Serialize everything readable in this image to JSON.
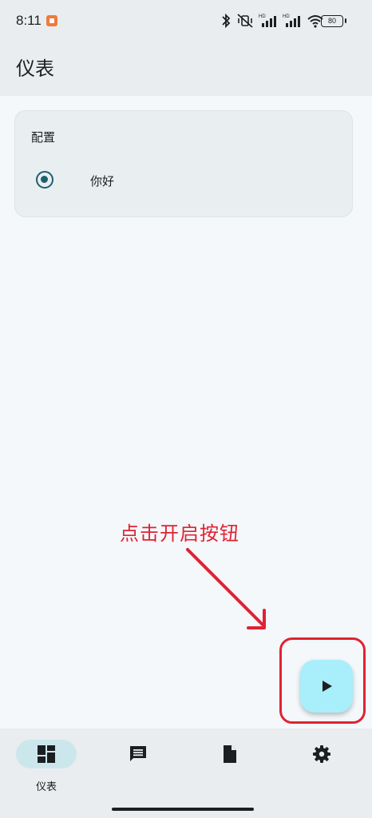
{
  "status_bar": {
    "time": "8:11",
    "battery": "80",
    "icons": [
      "bluetooth-icon",
      "vibrate-off-icon",
      "signal-hd-icon",
      "signal-hd-icon",
      "wifi-icon",
      "battery-icon"
    ]
  },
  "app_bar": {
    "title": "仪表"
  },
  "config_card": {
    "title": "配置",
    "options": [
      {
        "label": "你好",
        "selected": true
      }
    ]
  },
  "annotation": {
    "text": "点击开启按钮",
    "color": "#e02233"
  },
  "fab": {
    "icon": "play-icon",
    "color": "#a8eefb"
  },
  "bottom_nav": {
    "items": [
      {
        "label": "仪表",
        "icon": "dashboard-icon",
        "active": true
      },
      {
        "label": "",
        "icon": "message-icon",
        "active": false
      },
      {
        "label": "",
        "icon": "document-icon",
        "active": false
      },
      {
        "label": "",
        "icon": "settings-icon",
        "active": false
      }
    ]
  },
  "colors": {
    "accent": "#1e5f6e",
    "background": "#f4f8fa",
    "surface": "#e9edef",
    "active_pill": "#cce7ec"
  }
}
